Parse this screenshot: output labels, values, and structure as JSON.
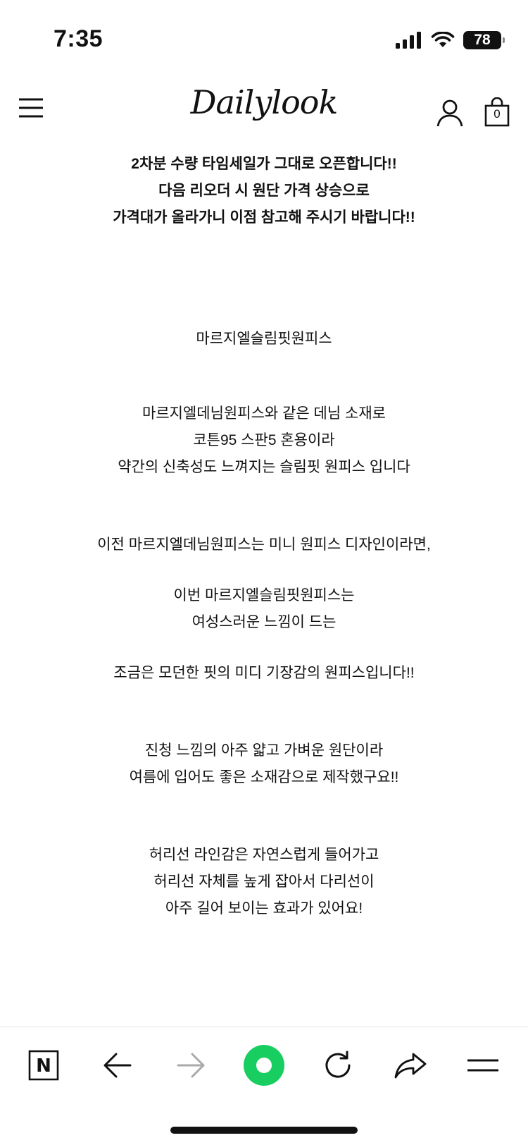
{
  "status_bar": {
    "time": "7:35",
    "battery": "78",
    "icons": [
      "signal-icon",
      "wifi-icon",
      "battery-icon"
    ]
  },
  "header": {
    "logo_text": "Dailylook",
    "cart_count": "0",
    "icons": [
      "menu-icon",
      "user-icon",
      "shopping-bag-icon"
    ]
  },
  "notice": {
    "lines": [
      "2차분 수량 타임세일가 그대로 오픈합니다!!",
      "다음 리오더 시 원단 가격 상승으로",
      "가격대가 올라가니 이점 참고해 주시기 바랍니다!!"
    ]
  },
  "description": {
    "product_name": "마르지엘슬림핏원피스",
    "para1": [
      "마르지엘데님원피스와 같은 데님 소재로",
      "코튼95 스판5 혼용이라",
      "약간의 신축성도 느껴지는 슬림핏 원피스 입니다"
    ],
    "para2": [
      "이전 마르지엘데님원피스는 미니 원피스 디자인이라면,"
    ],
    "para3": [
      "이번 마르지엘슬림핏원피스는",
      "여성스러운 느낌이 드는"
    ],
    "para4": [
      "조금은 모던한 핏의 미디 기장감의 원피스입니다!!"
    ],
    "para5": [
      "진청 느낌의 아주 얇고 가벼운 원단이라",
      "여름에 입어도 좋은 소재감으로 제작했구요!!"
    ],
    "para6": [
      "허리선 라인감은 자연스럽게 들어가고",
      "허리선 자체를 높게 잡아서 다리선이",
      "아주 길어 보이는 효과가 있어요!"
    ]
  },
  "toolbar": {
    "home_letter": "N",
    "icons": [
      "naver-home-icon",
      "back-arrow-icon",
      "forward-arrow-icon",
      "green-dot-icon",
      "reload-icon",
      "share-icon",
      "menu-icon"
    ],
    "accent_color": "#19ce60"
  }
}
